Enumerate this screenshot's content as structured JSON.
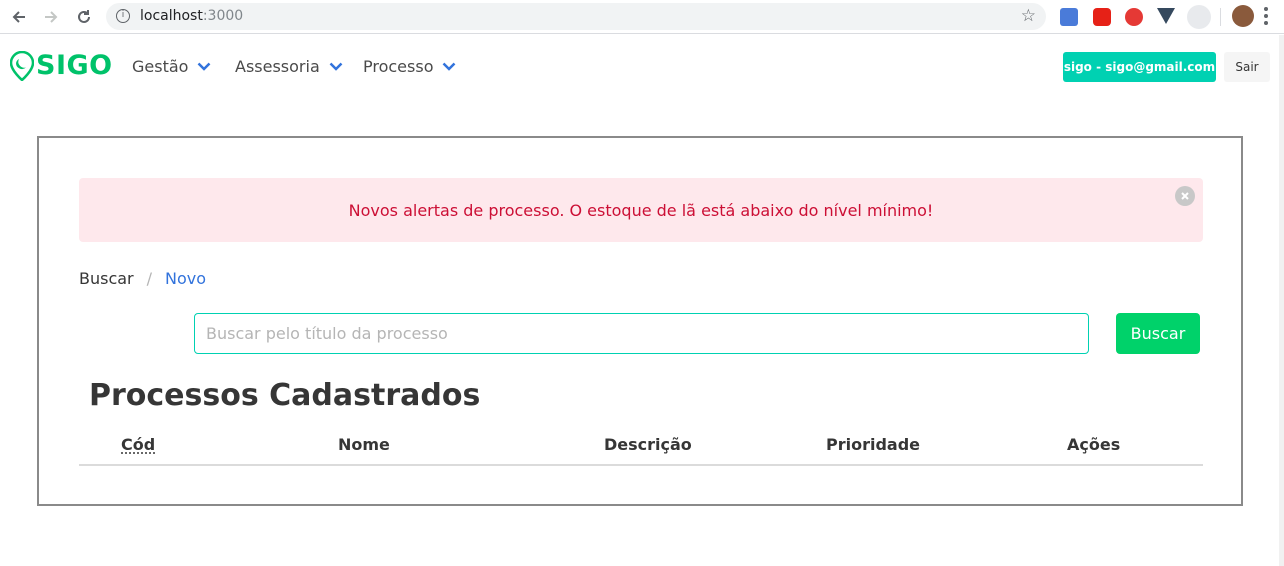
{
  "browser": {
    "url_host": "localhost",
    "url_port": ":3000"
  },
  "navbar": {
    "logo_text": "SIGO",
    "menu": [
      {
        "label": "Gestão"
      },
      {
        "label": "Assessoria"
      },
      {
        "label": "Processo"
      }
    ],
    "user_label": "sigo - sigo@gmail.com",
    "logout_label": "Sair"
  },
  "alert": {
    "message": "Novos alertas de processo. O estoque de lã está abaixo do nível mínimo!"
  },
  "breadcrumb": {
    "items": [
      "Buscar",
      "Novo"
    ],
    "separator": "/"
  },
  "search": {
    "placeholder": "Buscar pelo título da processo",
    "value": "",
    "button_label": "Buscar"
  },
  "page_title": "Processos Cadastrados",
  "table": {
    "columns": [
      "Cód",
      "Nome",
      "Descrição",
      "Prioridade",
      "Ações"
    ],
    "rows": []
  },
  "colors": {
    "brand": "#00c26a",
    "primary": "#00d1b2",
    "alert_bg": "#fee8ec",
    "alert_text": "#cc0f35",
    "link": "#3273dc"
  }
}
